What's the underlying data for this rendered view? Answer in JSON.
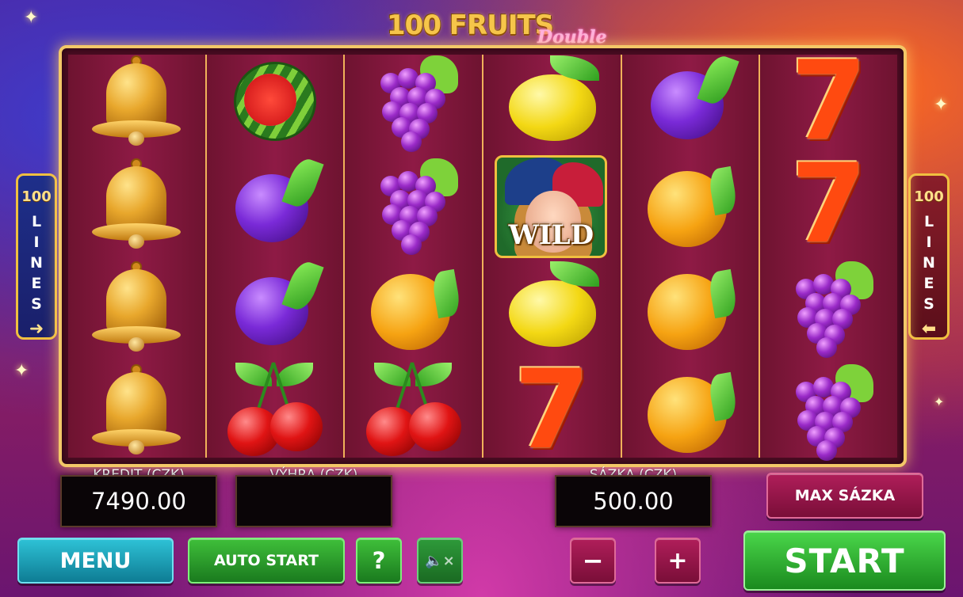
{
  "title": {
    "main": "100 FRUITS",
    "sub": "Double"
  },
  "lines": {
    "count": "100",
    "word_letters": [
      "L",
      "I",
      "N",
      "E",
      "S"
    ],
    "left_arrow": "➜",
    "right_arrow": "⬅"
  },
  "wild_label": "WILD",
  "reels": [
    [
      "bell",
      "bell",
      "bell",
      "bell"
    ],
    [
      "watermelon",
      "plum",
      "plum",
      "cherry"
    ],
    [
      "grapes",
      "grapes",
      "orange",
      "cherry"
    ],
    [
      "lemon",
      "wild",
      "lemon",
      "seven"
    ],
    [
      "plum",
      "orange",
      "orange",
      "orange"
    ],
    [
      "seven",
      "seven",
      "grapes",
      "grapes"
    ]
  ],
  "panels": {
    "credit": {
      "label": "KREDIT (CZK)",
      "value": "7490.00"
    },
    "win": {
      "label": "VÝHRA (CZK)",
      "value": ""
    },
    "bet": {
      "label": "SÁZKA (CZK)",
      "value": "500.00"
    }
  },
  "buttons": {
    "max_bet": "MAX SÁZKA",
    "menu": "MENU",
    "auto_start": "AUTO START",
    "help": "?",
    "mute": "🔈×",
    "minus": "−",
    "plus": "+",
    "start": "START"
  },
  "colors": {
    "frame_gold": "#f3c868",
    "reel_bg": "#8e1a45",
    "start_green": "#1a8a1e",
    "menu_teal": "#0e7c94",
    "max_bet_maroon": "#7a0e38"
  }
}
